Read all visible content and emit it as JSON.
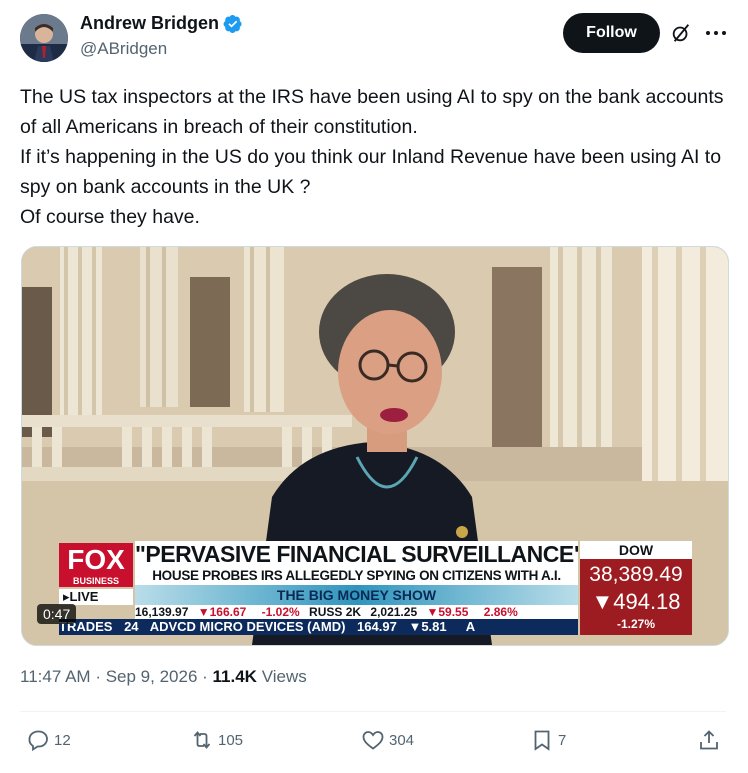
{
  "author": {
    "name": "Andrew Bridgen",
    "handle": "@ABridgen",
    "verified": true
  },
  "header": {
    "follow_label": "Follow",
    "grok_icon": "grok-icon",
    "more_icon": "more-icon"
  },
  "tweet": {
    "text": "The US tax inspectors at the IRS have been using AI to spy on the bank accounts of all Americans in breach of their constitution.\nIf it’s happening in the US do you think our Inland Revenue have been using AI to spy on bank accounts in the UK ?\nOf course they have."
  },
  "video": {
    "duration": "0:47",
    "chyron": {
      "network": "FOX",
      "network_sub": "BUSINESS",
      "live": "LIVE",
      "headline": "\"PERVASIVE FINANCIAL SURVEILLANCE\"",
      "subhead": "HOUSE PROBES IRS ALLEGEDLY SPYING ON CITIZENS WITH A.I.",
      "show": "THE BIG MONEY SHOW",
      "dow_label": "DOW",
      "dow_value": "38,389.49",
      "dow_change": "494.18",
      "dow_pct": "-1.27%",
      "market_1_value": "16,139.97",
      "market_1_change": "166.67",
      "market_1_pct": "-1.02%",
      "market_2_name": "RUSS 2K",
      "market_2_value": "2,021.25",
      "market_2_change": "59.55",
      "market_2_pct": "2.86%",
      "trades_label": "TRADES",
      "trades_value": "24",
      "stock_name": "ADVCD MICRO DEVICES (AMD)",
      "stock_value": "164.97",
      "stock_change": "5.81",
      "stock_tail": "A"
    }
  },
  "meta": {
    "time": "11:47 AM",
    "date": "Sep 9, 2026",
    "views_count": "11.4K",
    "views_label": "Views"
  },
  "actions": {
    "replies": "12",
    "reposts": "105",
    "likes": "304",
    "bookmarks": "7"
  },
  "colors": {
    "accent": "#1d9bf0",
    "text": "#0f1419",
    "secondary": "#536471",
    "fox_red": "#c8102e"
  }
}
